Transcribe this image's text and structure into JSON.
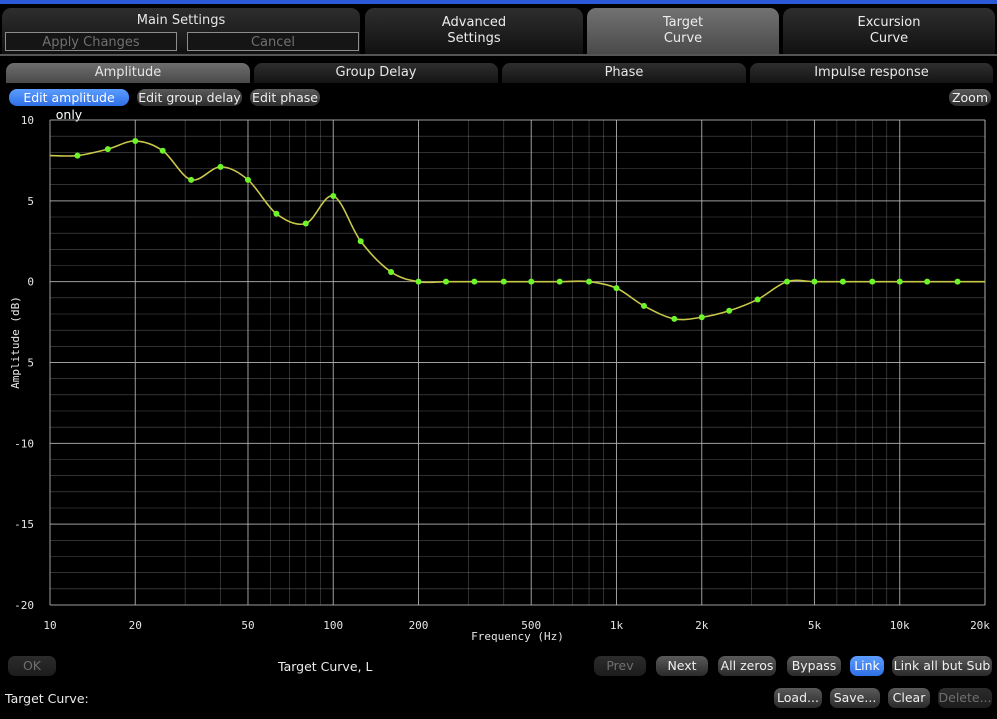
{
  "tabs": {
    "main_settings": {
      "title": "Main Settings",
      "apply": "Apply Changes",
      "cancel": "Cancel"
    },
    "advanced": {
      "line1": "Advanced",
      "line2": "Settings"
    },
    "target": {
      "line1": "Target",
      "line2": "Curve"
    },
    "excursion": {
      "line1": "Excursion",
      "line2": "Curve"
    }
  },
  "subtabs": [
    "Amplitude",
    "Group Delay",
    "Phase",
    "Impulse response"
  ],
  "modes": {
    "amplitude": "Edit amplitude only",
    "group": "Edit group delay",
    "phase": "Edit phase",
    "zoom": "Zoom"
  },
  "chart_data": {
    "type": "line",
    "xlabel": "Frequency (Hz)",
    "ylabel": "Amplitude (dB)",
    "x_scale": "log",
    "xlim": [
      10,
      20000
    ],
    "ylim": [
      -20,
      10
    ],
    "grid": true,
    "x_ticks": [
      {
        "v": 10,
        "label": "10"
      },
      {
        "v": 20,
        "label": "20"
      },
      {
        "v": 50,
        "label": "50"
      },
      {
        "v": 100,
        "label": "100"
      },
      {
        "v": 200,
        "label": "200"
      },
      {
        "v": 500,
        "label": "500"
      },
      {
        "v": 1000,
        "label": "1k"
      },
      {
        "v": 2000,
        "label": "2k"
      },
      {
        "v": 5000,
        "label": "5k"
      },
      {
        "v": 10000,
        "label": "10k"
      },
      {
        "v": 20000,
        "label": "20k"
      }
    ],
    "y_ticks": [
      {
        "v": 10,
        "label": "10"
      },
      {
        "v": 5,
        "label": "5"
      },
      {
        "v": 0,
        "label": "0"
      },
      {
        "v": -5,
        "label": "5"
      },
      {
        "v": -10,
        "label": "-10"
      },
      {
        "v": -15,
        "label": "-15"
      },
      {
        "v": -20,
        "label": "-20"
      }
    ],
    "points": [
      {
        "x": 12.5,
        "y": 7.8
      },
      {
        "x": 16,
        "y": 8.2
      },
      {
        "x": 20,
        "y": 8.7
      },
      {
        "x": 25,
        "y": 8.1
      },
      {
        "x": 31.5,
        "y": 6.3
      },
      {
        "x": 40,
        "y": 7.1
      },
      {
        "x": 50,
        "y": 6.3
      },
      {
        "x": 63,
        "y": 4.2
      },
      {
        "x": 80,
        "y": 3.6
      },
      {
        "x": 100,
        "y": 5.3
      },
      {
        "x": 125,
        "y": 2.5
      },
      {
        "x": 160,
        "y": 0.6
      },
      {
        "x": 200,
        "y": 0
      },
      {
        "x": 250,
        "y": 0
      },
      {
        "x": 315,
        "y": 0
      },
      {
        "x": 400,
        "y": 0
      },
      {
        "x": 500,
        "y": 0
      },
      {
        "x": 630,
        "y": 0
      },
      {
        "x": 800,
        "y": 0
      },
      {
        "x": 1000,
        "y": -0.4
      },
      {
        "x": 1250,
        "y": -1.5
      },
      {
        "x": 1600,
        "y": -2.3
      },
      {
        "x": 2000,
        "y": -2.2
      },
      {
        "x": 2500,
        "y": -1.8
      },
      {
        "x": 3150,
        "y": -1.1
      },
      {
        "x": 4000,
        "y": 0
      },
      {
        "x": 5000,
        "y": 0
      },
      {
        "x": 6300,
        "y": 0
      },
      {
        "x": 8000,
        "y": 0
      },
      {
        "x": 10000,
        "y": 0
      },
      {
        "x": 12500,
        "y": 0
      },
      {
        "x": 16000,
        "y": 0
      }
    ],
    "curve_start": {
      "x": 10,
      "y": 7.8
    },
    "curve_end": {
      "x": 20000,
      "y": 0
    },
    "colors": {
      "curve": "#c8c84a",
      "point": "#6cf52a",
      "grid": "#b0b0b0"
    }
  },
  "footer": {
    "ok": "OK",
    "curve_name": "Target Curve, L",
    "prev": "Prev",
    "next": "Next",
    "all_zeros": "All zeros",
    "bypass": "Bypass",
    "link": "Link",
    "link_all_but_sub": "Link all but Sub",
    "target_curve_label": "Target Curve:",
    "load": "Load...",
    "save": "Save...",
    "clear": "Clear",
    "delete": "Delete..."
  }
}
